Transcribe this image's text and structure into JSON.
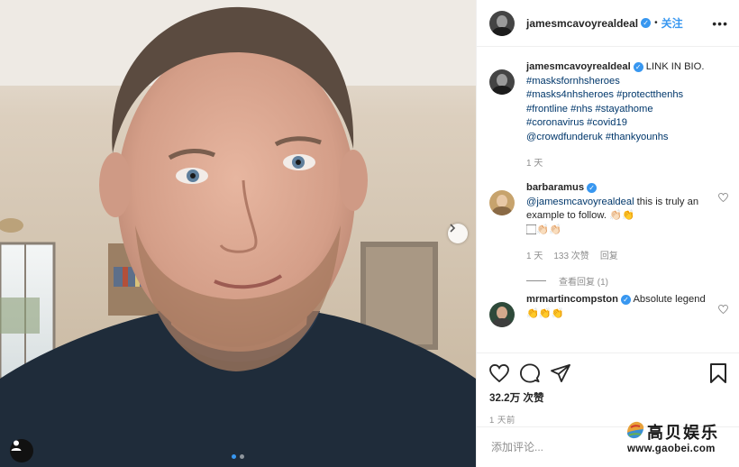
{
  "post": {
    "author": "jamesmcavoyrealdeal",
    "header_separator": "•",
    "follow_label": "关注",
    "more_icon": "more-horizontal-icon",
    "caption": {
      "username": "jamesmcavoyrealdeal",
      "text_intro": "LINK IN BIO.",
      "tags": [
        "#masksfornhsheroes",
        "#masks4nhsheroes",
        "#protectthenhs",
        "#frontline",
        "#nhs",
        "#stayathome",
        "#coronavirus",
        "#covid19",
        "@crowdfunderuk",
        "#thankyounhs"
      ],
      "time": "1 天"
    },
    "comments": [
      {
        "username": "barbaramus",
        "mention": "@jamesmcavoyrealdeal",
        "text": " this is truly an example to follow. 👏🏻👏",
        "text2": "🏻👏🏻👏🏻",
        "time": "1 天",
        "likes": "133 次赞",
        "reply_label": "回复",
        "view_replies": "查看回复 (1)"
      },
      {
        "username": "mrmartincompston",
        "text": " Absolute legend 👏👏👏"
      }
    ],
    "likes_count": "32.2万 次赞",
    "posted": "1 天前",
    "comment_placeholder": "添加评论...",
    "carousel": {
      "slides": 2,
      "active": 1
    }
  },
  "watermark": {
    "title": "高贝娱乐",
    "url": "www.gaobei.com"
  },
  "colors": {
    "accent": "#3897f0",
    "text": "#262626",
    "secondary": "#8e8e8e",
    "link": "#00376b"
  }
}
